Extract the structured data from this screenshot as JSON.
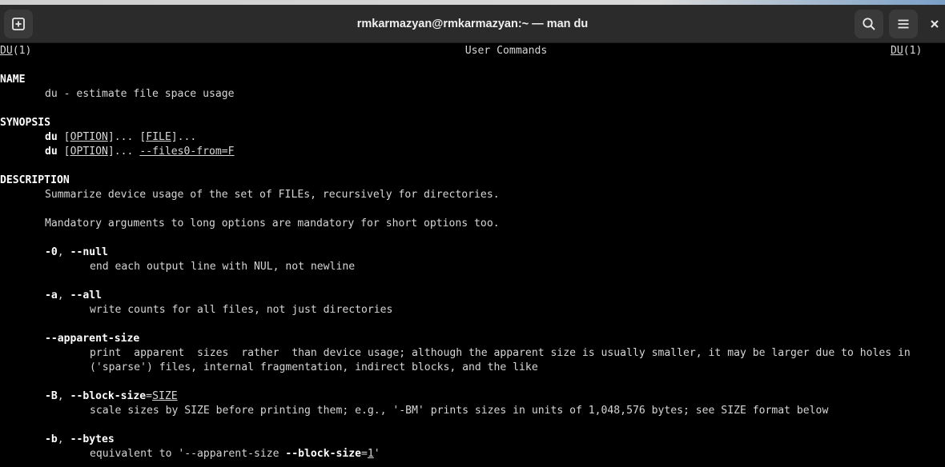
{
  "window": {
    "title": "rmkarmazyan@rmkarmazyan:~ — man du",
    "new_tab_icon": "new-tab-icon",
    "search_icon": "search-icon",
    "menu_icon": "hamburger-menu-icon",
    "close_label": "×"
  },
  "man": {
    "header_left_name": "DU",
    "header_left_section": "(1)",
    "header_center": "User Commands",
    "header_right_name": "DU",
    "header_right_section": "(1)",
    "name_heading": "NAME",
    "name_text": "du - estimate file space usage",
    "synopsis_heading": "SYNOPSIS",
    "synopsis": [
      {
        "cmd": "du",
        "sp1": " ",
        "arg1": "OPTION",
        "mid": "... ",
        "arg2": "FILE",
        "end": "..."
      },
      {
        "cmd": "du",
        "sp1": " ",
        "arg1": "OPTION",
        "mid": "... ",
        "arg2": "--files0-from=F",
        "end": ""
      }
    ],
    "description_heading": "DESCRIPTION",
    "desc_line1": "Summarize device usage of the set of FILEs, recursively for directories.",
    "desc_line2": "Mandatory arguments to long options are mandatory for short options too.",
    "options": [
      {
        "short": "-0",
        "sep": ", ",
        "long": "--null",
        "desc": [
          "end each output line with NUL, not newline"
        ]
      },
      {
        "short": "-a",
        "sep": ", ",
        "long": "--all",
        "desc": [
          "write counts for all files, not just directories"
        ]
      },
      {
        "long": "--apparent-size",
        "desc": [
          "print  apparent  sizes  rather  than device usage; although the apparent size is usually smaller, it may be larger due to holes in",
          "('sparse') files, internal fragmentation, indirect blocks, and the like"
        ]
      },
      {
        "short": "-B",
        "sep": ", ",
        "long": "--block-size",
        "eq": "=",
        "arg": "SIZE",
        "desc": [
          "scale sizes by SIZE before printing them; e.g., '-BM' prints sizes in units of 1,048,576 bytes; see SIZE format below"
        ]
      },
      {
        "short": "-b",
        "sep": ", ",
        "long": "--bytes",
        "desc_pre": "equivalent to '--apparent-size ",
        "desc_bold": "--block-size",
        "desc_eq": "=",
        "desc_arg": "1",
        "desc_post": "'"
      }
    ]
  }
}
